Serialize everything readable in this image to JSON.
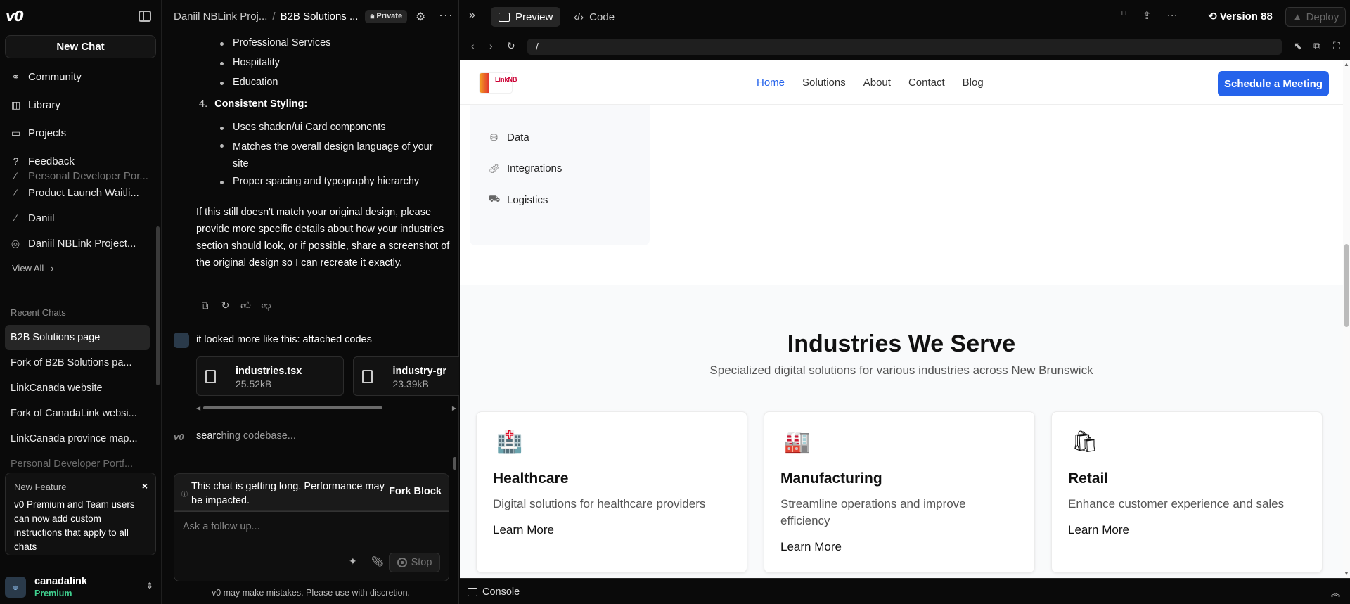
{
  "sidebar": {
    "new_chat": "New Chat",
    "nav": [
      {
        "label": "Community",
        "icon": "community-icon"
      },
      {
        "label": "Library",
        "icon": "book-icon"
      },
      {
        "label": "Projects",
        "icon": "folder-icon"
      },
      {
        "label": "Feedback",
        "icon": "help-icon"
      }
    ],
    "projects": [
      {
        "label": "Personal Developer Por..."
      },
      {
        "label": "Product Launch Waitli..."
      },
      {
        "label": "Daniil"
      },
      {
        "label": "Daniil NBLink Project..."
      }
    ],
    "view_all": "View All",
    "recent_header": "Recent Chats",
    "recent": [
      {
        "label": "B2B Solutions page"
      },
      {
        "label": "Fork of B2B Solutions pa..."
      },
      {
        "label": "LinkCanada website"
      },
      {
        "label": "Fork of CanadaLink websi..."
      },
      {
        "label": "LinkCanada province map..."
      },
      {
        "label": "Personal Developer Portf..."
      }
    ],
    "feature": {
      "title": "New Feature",
      "body": "v0 Premium and Team users can now add custom instructions that apply to all chats"
    },
    "user": {
      "name": "canadalink",
      "plan": "Premium"
    }
  },
  "chat": {
    "crumb_project": "Daniil NBLink Proj...",
    "crumb_chat": "B2B Solutions ...",
    "privacy": "Private",
    "bullets_top": [
      "Professional Services",
      "Hospitality",
      "Education"
    ],
    "item4_num": "4.",
    "item4_title": "Consistent Styling:",
    "bullets_item4": [
      "Uses shadcn/ui Card components",
      "Matches the overall design language of your site",
      "Proper spacing and typography hierarchy"
    ],
    "paragraph": "If this still doesn't match your original design, please provide more specific details about how your industries section should look, or if possible, share a screenshot of the original design so I can recreate it exactly.",
    "user_message": "it looked more like this: attached codes",
    "files": [
      {
        "name": "industries.tsx",
        "size": "25.52kB"
      },
      {
        "name": "industry-gr",
        "size": "23.39kB"
      }
    ],
    "status_a": "searc",
    "status_b": "hing codebase...",
    "warning": "This chat is getting long. Performance may be impacted.",
    "fork_label": "Fork Block",
    "placeholder": "Ask a follow up...",
    "stop_label": "Stop",
    "disclaimer": "v0 may make mistakes. Please use with discretion."
  },
  "preview": {
    "tab_preview": "Preview",
    "tab_code": "Code",
    "version": "Version 88",
    "deploy": "Deploy",
    "url": "/",
    "console": "Console",
    "site": {
      "logo_text": "LinkNB",
      "nav": [
        "Home",
        "Solutions",
        "About",
        "Contact",
        "Blog"
      ],
      "cta": "Schedule a Meeting",
      "categories": [
        {
          "label": "Data",
          "icon": "database-icon"
        },
        {
          "label": "Integrations",
          "icon": "link-icon"
        },
        {
          "label": "Logistics",
          "icon": "truck-icon"
        }
      ],
      "section_title": "Industries We Serve",
      "section_subtitle": "Specialized digital solutions for various industries across New Brunswick",
      "cards": [
        {
          "title": "Healthcare",
          "desc": "Digital solutions for healthcare providers",
          "link": "Learn More",
          "icon": "hospital-icon"
        },
        {
          "title": "Manufacturing",
          "desc": "Streamline operations and improve efficiency",
          "link": "Learn More",
          "icon": "factory-icon"
        },
        {
          "title": "Retail",
          "desc": "Enhance customer experience and sales",
          "link": "Learn More",
          "icon": "shopping-bag-icon"
        }
      ]
    }
  },
  "colors": {
    "accent": "#2563eb",
    "premium": "#3fcf8e",
    "dark_bg": "#0a0a0a"
  }
}
